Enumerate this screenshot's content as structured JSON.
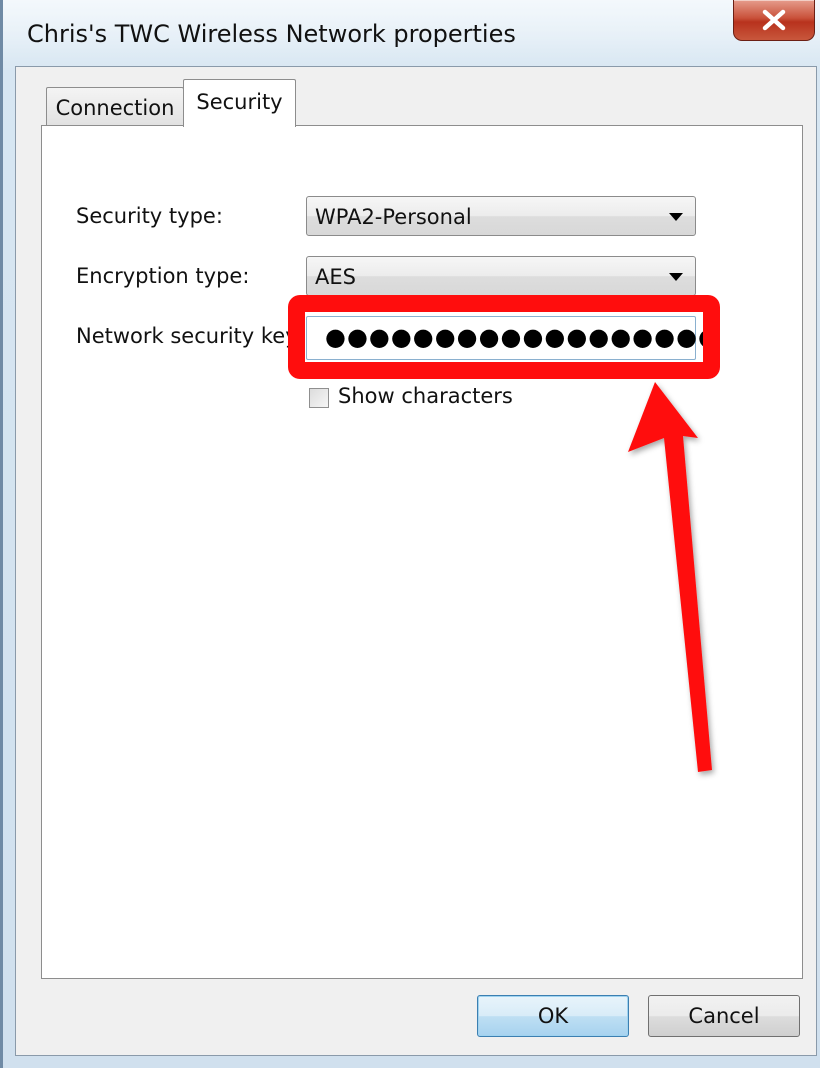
{
  "window": {
    "title": "Chris's TWC Wireless Network properties",
    "close_icon": "close-icon"
  },
  "tabs": [
    {
      "label": "Connection",
      "selected": false
    },
    {
      "label": "Security",
      "selected": true
    }
  ],
  "form": {
    "security_type": {
      "label": "Security type:",
      "value": "WPA2-Personal"
    },
    "encryption_type": {
      "label": "Encryption type:",
      "value": "AES"
    },
    "network_key": {
      "label": "Network security key",
      "masked_value": "●●●●●●●●●●●●●●●●●●"
    },
    "show_characters": {
      "label": "Show characters",
      "checked": false
    }
  },
  "buttons": {
    "ok": "OK",
    "cancel": "Cancel"
  },
  "annotation": {
    "color": "#ff0d0d",
    "shapes": [
      "highlight-box",
      "arrow"
    ]
  }
}
